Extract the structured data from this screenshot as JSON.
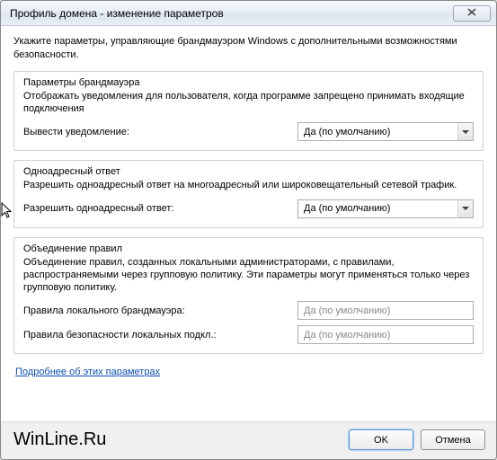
{
  "window": {
    "title": "Профиль домена - изменение параметров"
  },
  "intro": "Укажите параметры, управляющие брандмауэром Windows с дополнительными возможностями безопасности.",
  "group1": {
    "title": "Параметры брандмауэра",
    "desc": "Отображать уведомления для пользователя, когда программе запрещено принимать входящие подключения",
    "row_label": "Вывести уведомление:",
    "value": "Да (по умолчанию)"
  },
  "group2": {
    "title": "Одноадресный ответ",
    "desc": "Разрешить одноадресный ответ на многоадресный или широковещательный сетевой трафик.",
    "row_label": "Разрешить одноадресный ответ:",
    "value": "Да (по умолчанию)"
  },
  "group3": {
    "title": "Объединение правил",
    "desc": "Объединение правил, созданных локальными администраторами, с правилами, распространяемыми через групповую политику. Эти параметры могут применяться только через групповую политику.",
    "row1_label": "Правила локального брандмауэра:",
    "row1_value": "Да (по умолчанию)",
    "row2_label": "Правила безопасности локальных подкл.:",
    "row2_value": "Да (по умолчанию)"
  },
  "link": "Подробнее об этих параметрах",
  "buttons": {
    "ok": "OK",
    "cancel": "Отмена"
  },
  "watermark": "WinLine.Ru"
}
